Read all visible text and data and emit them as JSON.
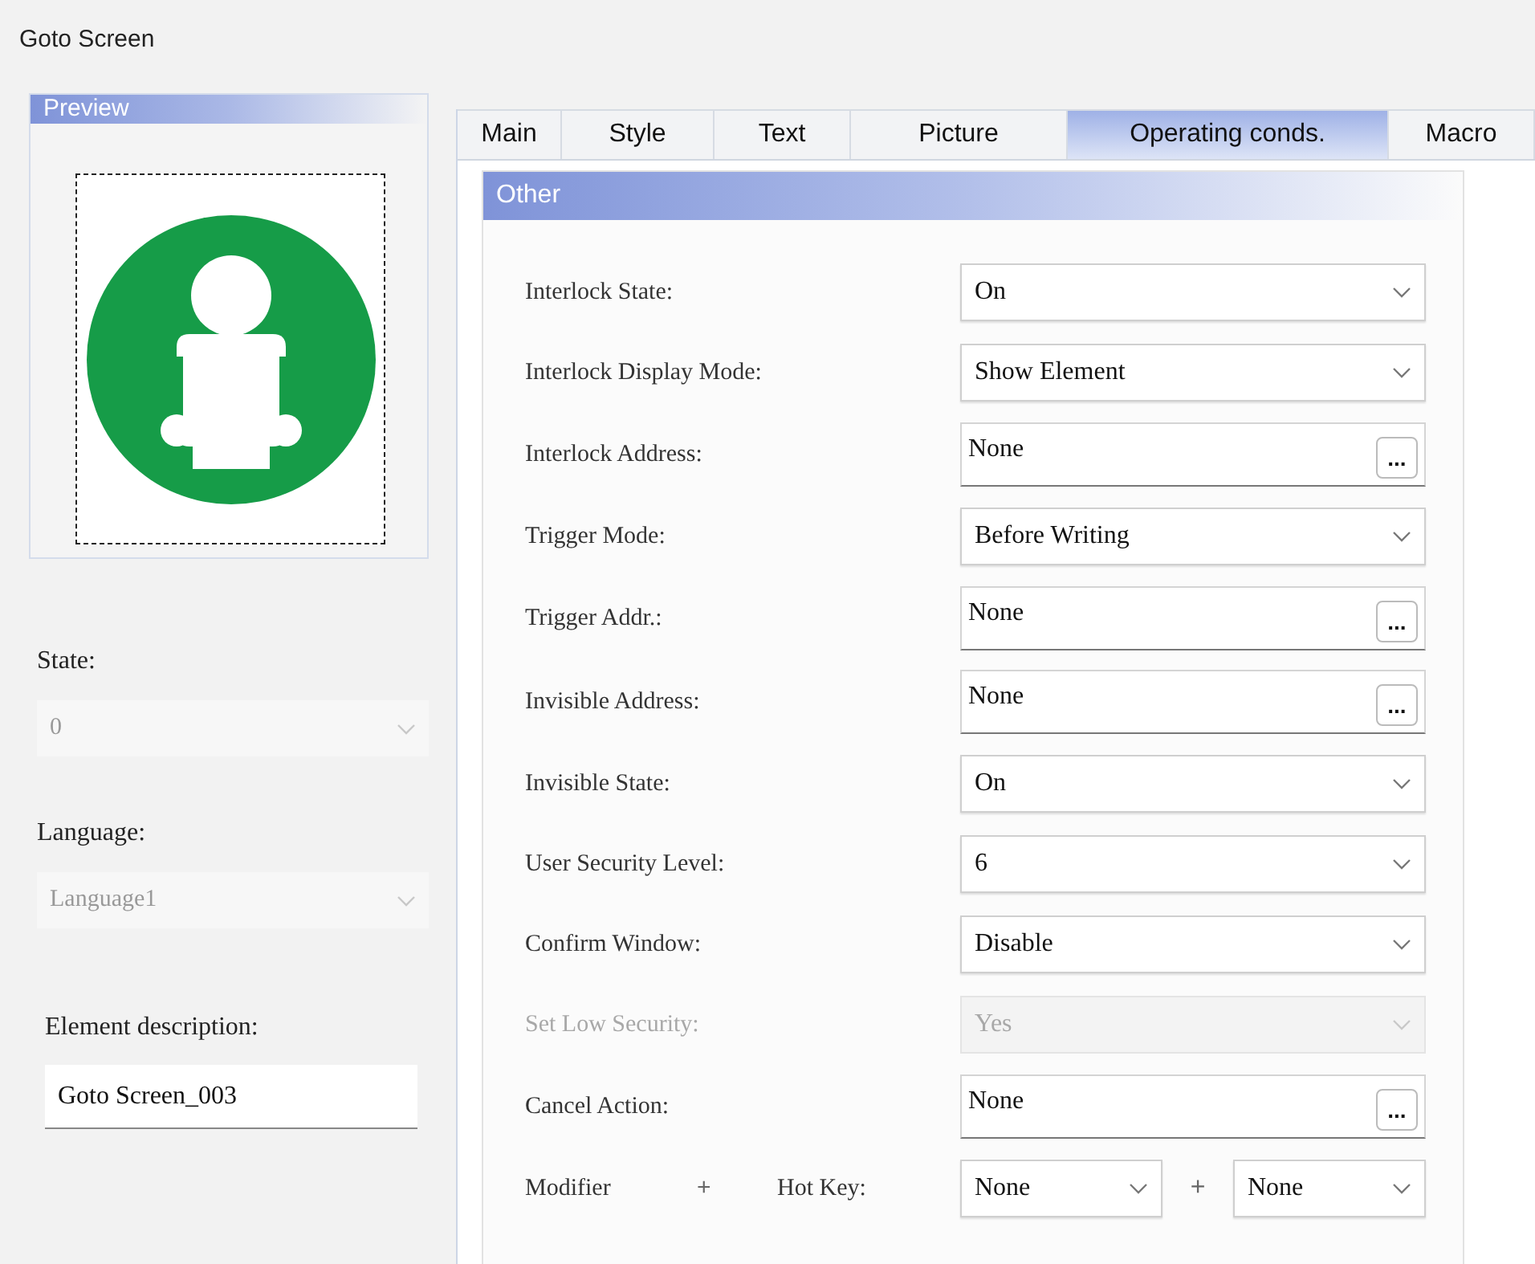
{
  "window": {
    "title": "Goto Screen"
  },
  "preview": {
    "title": "Preview"
  },
  "left_fields": [
    {
      "label": "State:",
      "value": "0",
      "disabled": true
    },
    {
      "label": "Language:",
      "value": "Language1",
      "disabled": true
    }
  ],
  "description": {
    "label": "Element description:",
    "value": "Goto Screen_003"
  },
  "tabs": [
    {
      "label": "Main",
      "selected": false
    },
    {
      "label": "Style",
      "selected": false
    },
    {
      "label": "Text",
      "selected": false
    },
    {
      "label": "Picture",
      "selected": false
    },
    {
      "label": "Operating conds.",
      "selected": true
    },
    {
      "label": "Macro",
      "selected": false
    }
  ],
  "section": {
    "title": "Other",
    "rows": [
      {
        "kind": "select",
        "label": "Interlock State:",
        "value": "On",
        "disabled": false
      },
      {
        "kind": "select",
        "label": "Interlock Display Mode:",
        "value": "Show Element",
        "disabled": false
      },
      {
        "kind": "address",
        "label": "Interlock Address:",
        "value": "None",
        "button": "...",
        "disabled": false
      },
      {
        "kind": "select",
        "label": "Trigger Mode:",
        "value": "Before Writing",
        "disabled": false
      },
      {
        "kind": "address",
        "label": "Trigger Addr.:",
        "value": "None",
        "button": "...",
        "disabled": false
      },
      {
        "kind": "address",
        "label": "Invisible Address:",
        "value": "None",
        "button": "...",
        "disabled": false
      },
      {
        "kind": "select",
        "label": "Invisible State:",
        "value": "On",
        "disabled": false
      },
      {
        "kind": "select",
        "label": "User Security Level:",
        "value": "6",
        "disabled": false
      },
      {
        "kind": "select",
        "label": "Confirm Window:",
        "value": "Disable",
        "disabled": false
      },
      {
        "kind": "select",
        "label": "Set Low Security:",
        "value": "Yes",
        "disabled": true
      },
      {
        "kind": "address",
        "label": "Cancel Action:",
        "value": "None",
        "button": "...",
        "disabled": false
      },
      {
        "kind": "hotkey",
        "label": "Modifier",
        "plus": "+",
        "label2": "Hot Key:",
        "value": "None",
        "plus2": "+",
        "value2": "None",
        "disabled": false
      }
    ]
  }
}
